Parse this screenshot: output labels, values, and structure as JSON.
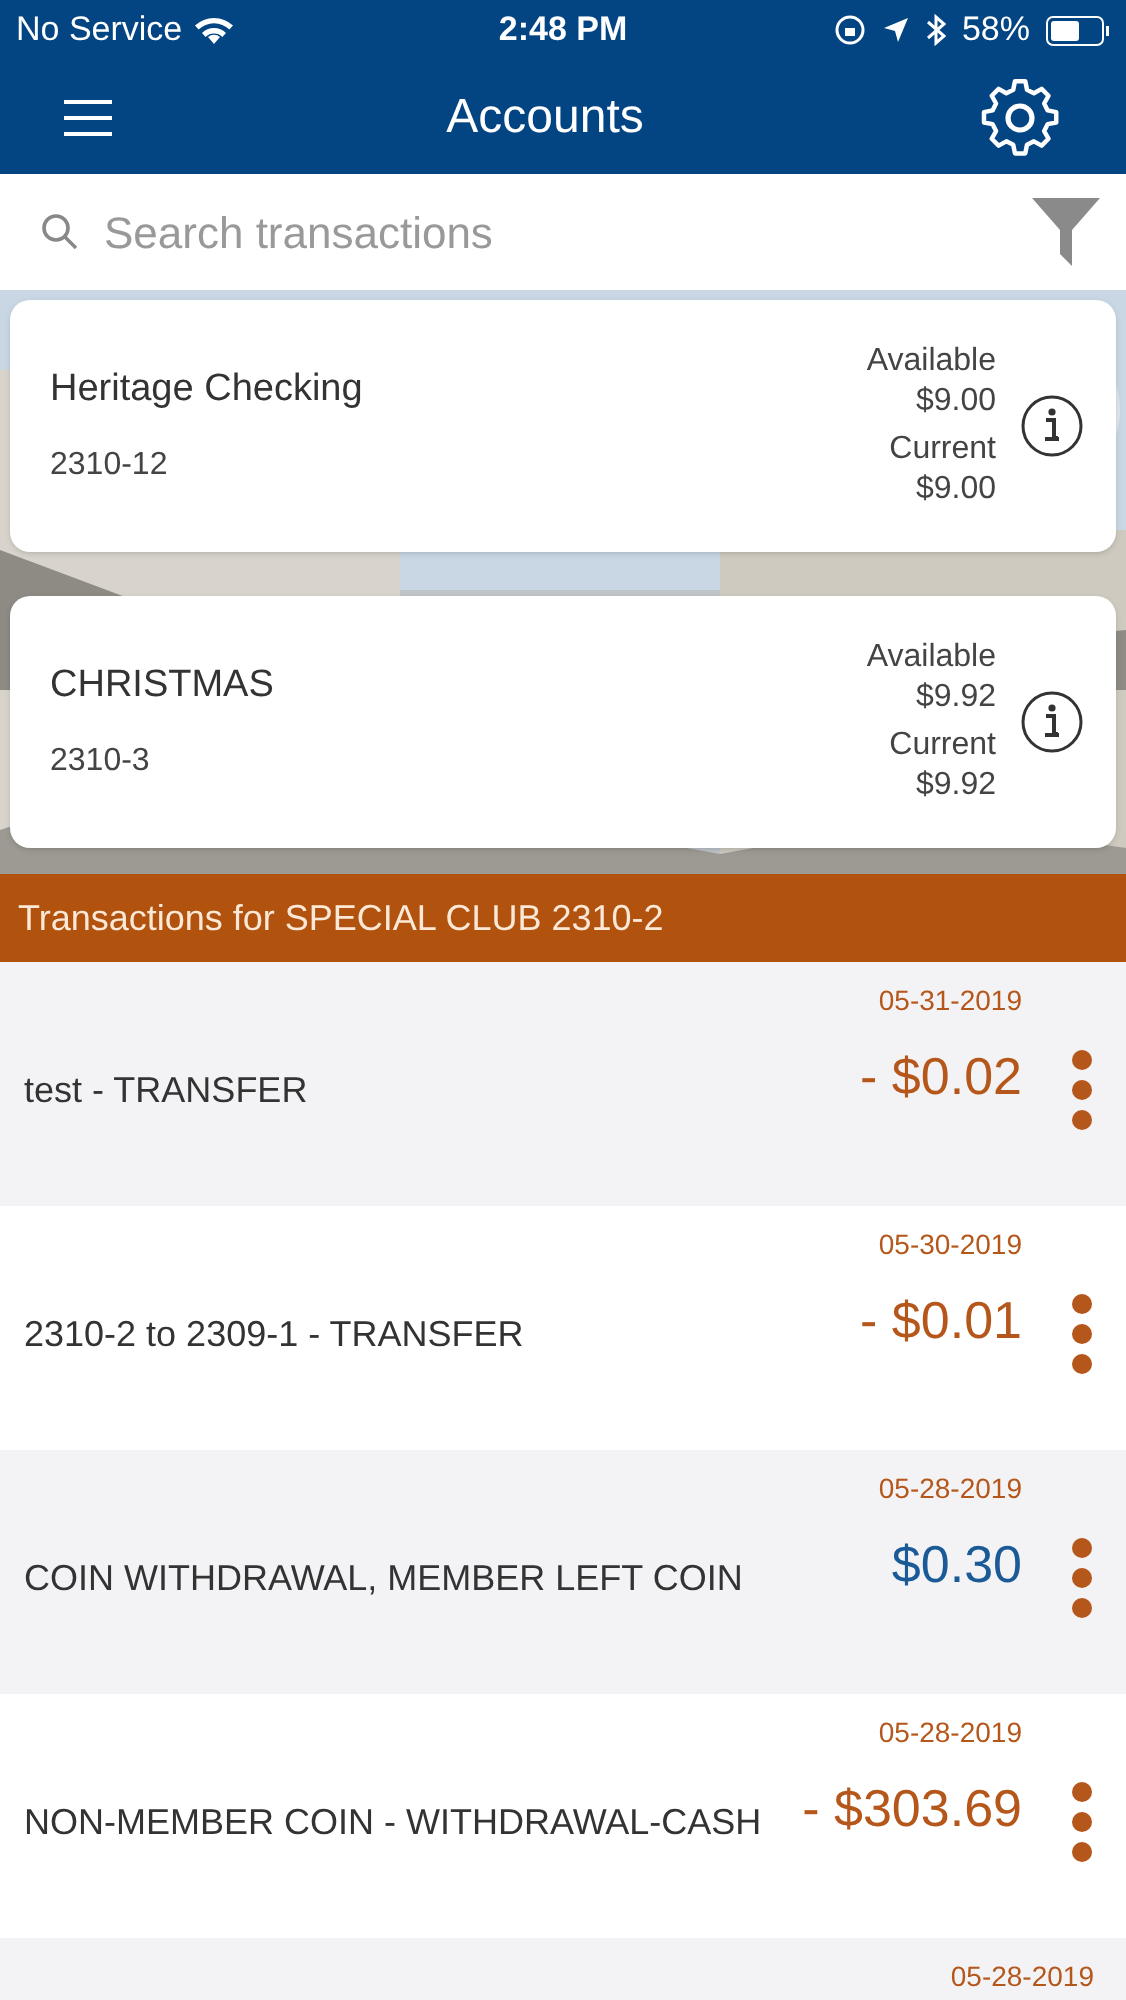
{
  "status_bar": {
    "carrier": "No Service",
    "time": "2:48 PM",
    "battery": "58%"
  },
  "nav": {
    "title": "Accounts"
  },
  "search": {
    "placeholder": "Search transactions"
  },
  "accounts": [
    {
      "name": "Heritage Checking",
      "number": "2310-12",
      "available_label": "Available",
      "available": "$9.00",
      "current_label": "Current",
      "current": "$9.00"
    },
    {
      "name": "CHRISTMAS",
      "number": "2310-3",
      "available_label": "Available",
      "available": "$9.92",
      "current_label": "Current",
      "current": "$9.92"
    }
  ],
  "transactions_header": "Transactions for SPECIAL CLUB 2310-2",
  "transactions": [
    {
      "date": "05-31-2019",
      "description": "test - TRANSFER",
      "amount": "- $0.02",
      "kind": "debit"
    },
    {
      "date": "05-30-2019",
      "description": "2310-2 to 2309-1 - TRANSFER",
      "amount": "- $0.01",
      "kind": "debit"
    },
    {
      "date": "05-28-2019",
      "description": "COIN WITHDRAWAL, MEMBER LEFT COIN",
      "amount": "$0.30",
      "kind": "credit"
    },
    {
      "date": "05-28-2019",
      "description": "NON-MEMBER COIN - WITHDRAWAL-CASH",
      "amount": "- $303.69",
      "kind": "debit"
    },
    {
      "date": "05-28-2019"
    }
  ]
}
